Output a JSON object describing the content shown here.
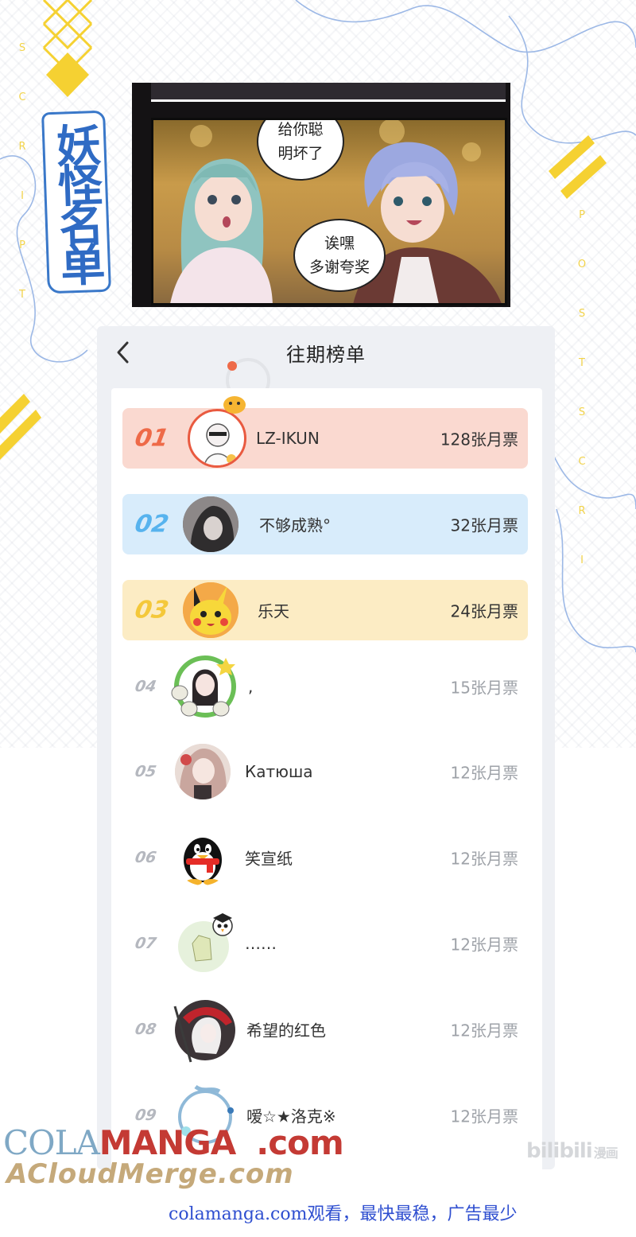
{
  "background": {
    "side_text_left": [
      "S",
      "C",
      "R",
      "I",
      "P",
      "T"
    ],
    "side_text_right": [
      "P",
      "O",
      "S",
      "T",
      "S",
      "C",
      "R",
      "I"
    ],
    "logo_text": "妖怪名单",
    "accent_yellow": "#f5d132",
    "line_blue": "#9cb8e6"
  },
  "comic": {
    "bubble1_lines": [
      "给你聪",
      "明坏了"
    ],
    "bubble2_lines": [
      "诶嘿",
      "多谢夸奖"
    ]
  },
  "panel": {
    "title": "往期榜单",
    "back_icon": "chevron-left-icon",
    "colors": {
      "rank1_bg": "#fad9d0",
      "rank1_text": "#ee6a48",
      "rank2_bg": "#d8ecfb",
      "rank2_text": "#57b3ee",
      "rank3_bg": "#fcecc4",
      "rank3_text": "#f4c83a"
    },
    "ranking": [
      {
        "rank": "01",
        "name": "LZ-IKUN",
        "tickets": "128张月票"
      },
      {
        "rank": "02",
        "name": "不够成熟°",
        "tickets": "32张月票"
      },
      {
        "rank": "03",
        "name": "乐天",
        "tickets": "24张月票"
      },
      {
        "rank": "04",
        "name": ",",
        "tickets": "15张月票"
      },
      {
        "rank": "05",
        "name": "Катюша",
        "tickets": "12张月票"
      },
      {
        "rank": "06",
        "name": "笑宣纸",
        "tickets": "12张月票"
      },
      {
        "rank": "07",
        "name": "……",
        "tickets": "12张月票"
      },
      {
        "rank": "08",
        "name": "希望的红色",
        "tickets": "12张月票"
      },
      {
        "rank": "09",
        "name": "嗳☆★洛克※",
        "tickets": "12张月票"
      }
    ]
  },
  "watermarks": {
    "colamanga_part1": "COLA",
    "colamanga_part2": "MANGA",
    "colamanga_part3": ".com",
    "acloud": "ACloudMerge.com",
    "bilibili": "bilibili",
    "bilibili_sub": "漫画",
    "footer": "colamanga.com观看，最快最稳，广告最少"
  }
}
